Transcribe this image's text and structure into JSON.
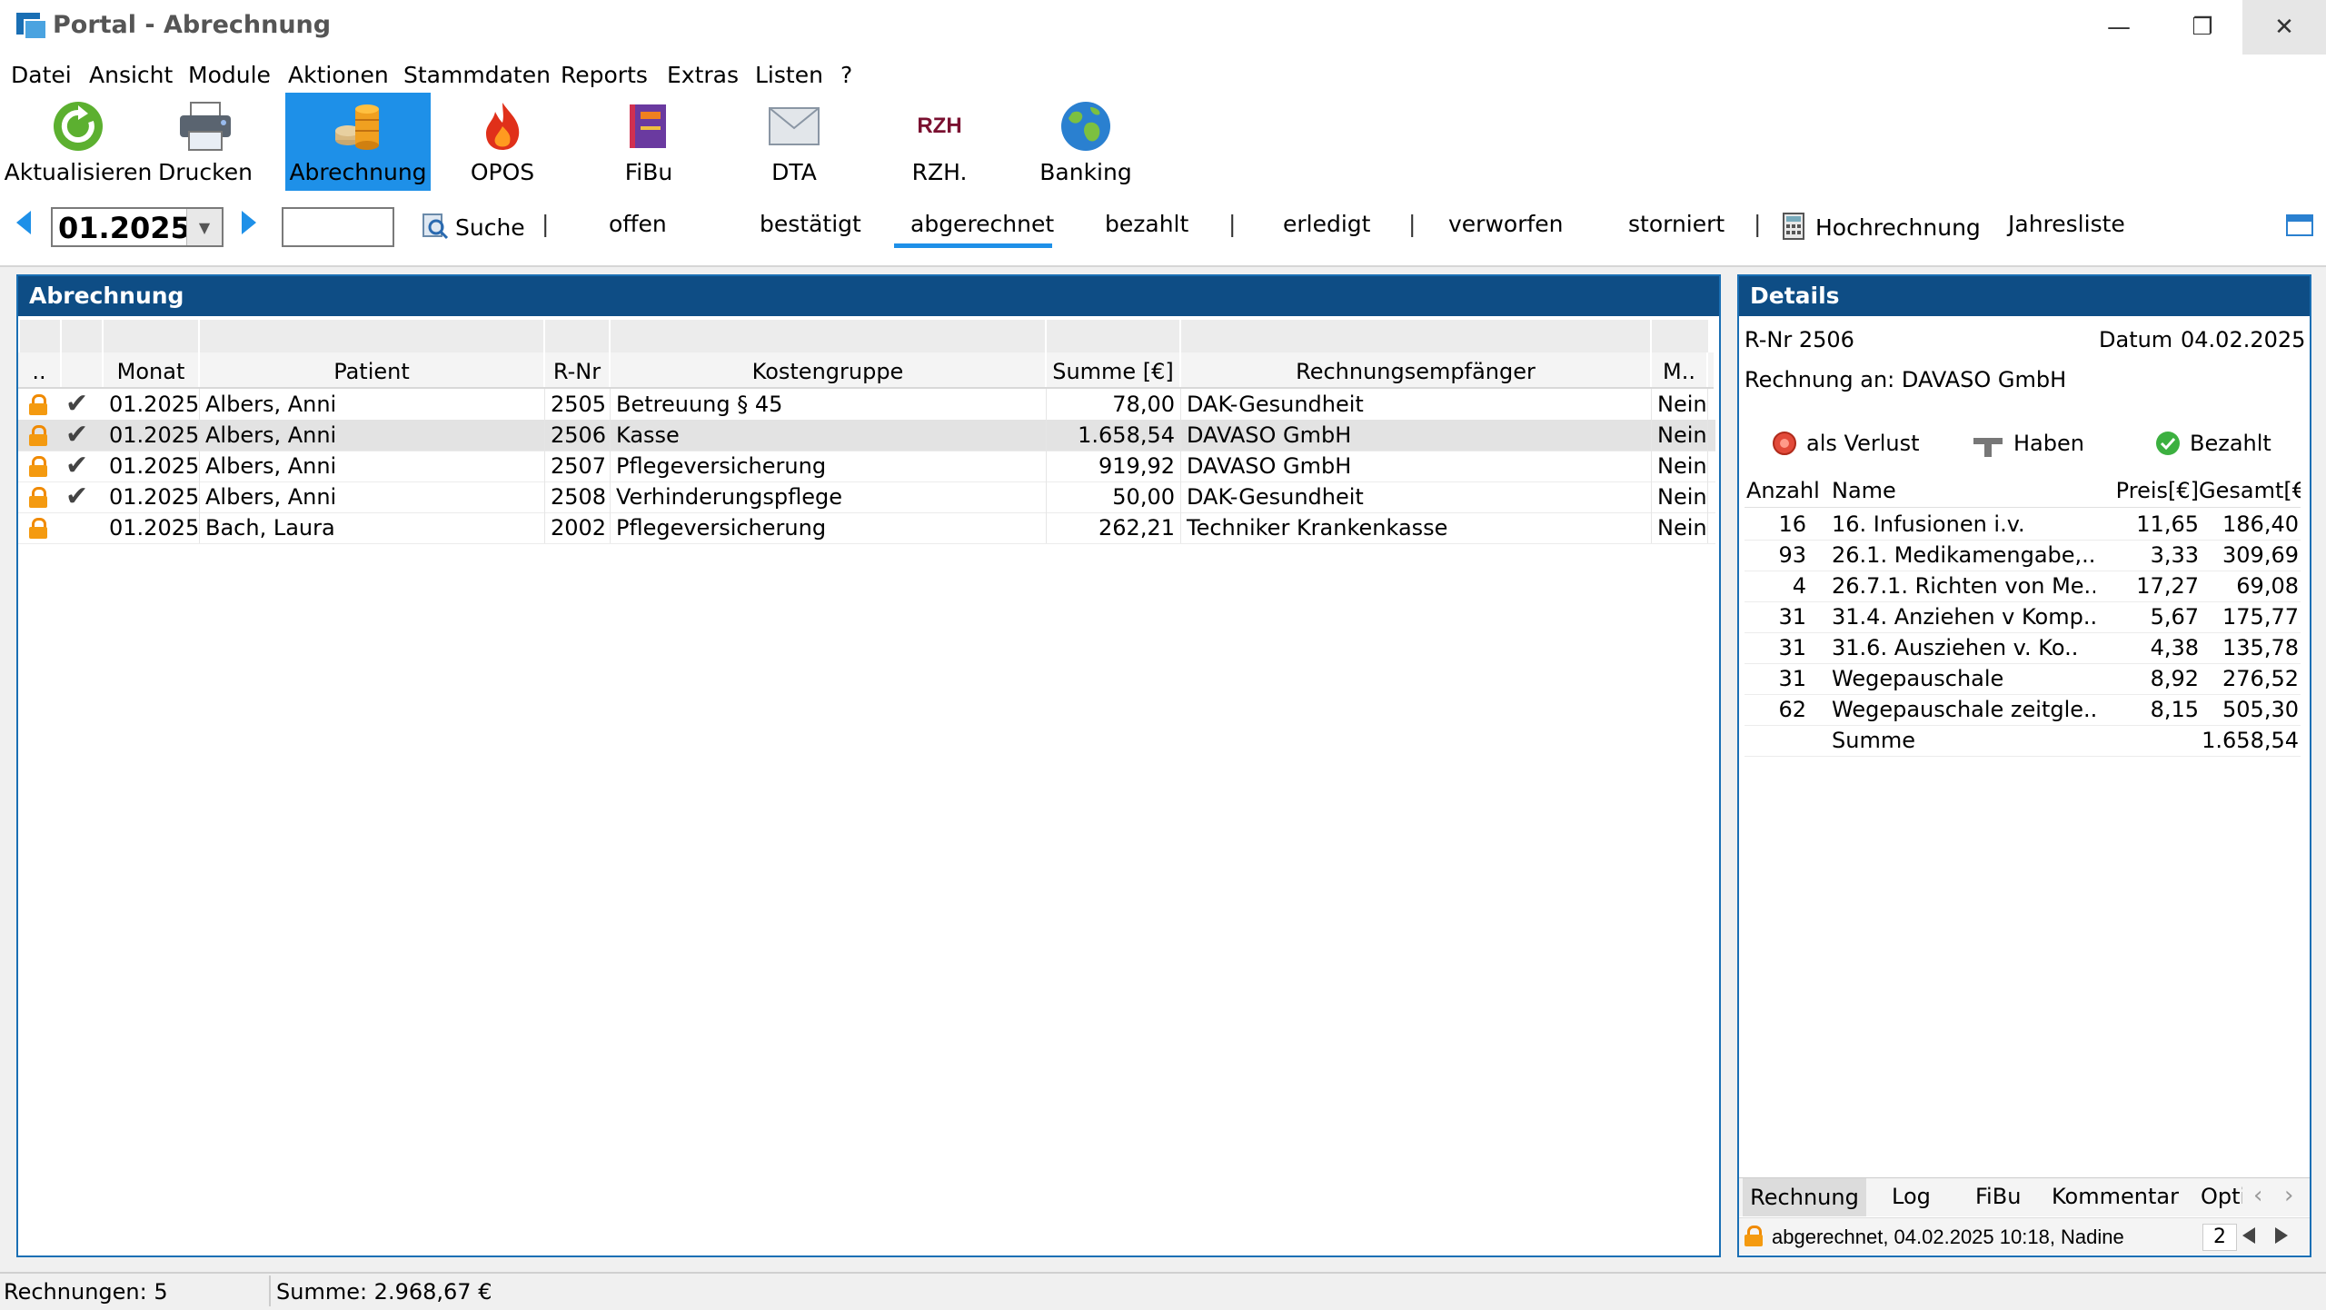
{
  "window": {
    "title": "Portal - Abrechnung"
  },
  "menu": [
    "Datei",
    "Ansicht",
    "Module",
    "Aktionen",
    "Stammdaten",
    "Reports",
    "Extras",
    "Listen",
    "?"
  ],
  "toolbar": {
    "refresh": "Aktualisieren",
    "print": "Drucken",
    "billing": "Abrechnung",
    "opos": "OPOS",
    "fibu": "FiBu",
    "dta": "DTA",
    "rzh": "RZH.",
    "rzh_logo": "RZH",
    "banking": "Banking"
  },
  "filter": {
    "month": "01.2025",
    "search_value": "",
    "search_label": "Suche",
    "tabs": [
      "offen",
      "bestätigt",
      "abgerechnet",
      "bezahlt",
      "erledigt",
      "verworfen",
      "storniert"
    ],
    "active_tab": "abgerechnet",
    "forecast": "Hochrechnung",
    "annual": "Jahresliste"
  },
  "billing_panel": {
    "title": "Abrechnung",
    "columns": [
      "..",
      "Monat",
      "Patient",
      "R-Nr",
      "Kostengruppe",
      "Summe [€]",
      "Rechnungsempfänger",
      "M.."
    ],
    "rows": [
      {
        "locked": true,
        "checked": true,
        "month": "01.2025",
        "patient": "Albers, Anni",
        "rnr": "2505",
        "group": "Betreuung § 45",
        "sum": "78,00",
        "recipient": "DAK-Gesundheit",
        "m": "Nein",
        "selected": false
      },
      {
        "locked": true,
        "checked": true,
        "month": "01.2025",
        "patient": "Albers, Anni",
        "rnr": "2506",
        "group": "Kasse",
        "sum": "1.658,54",
        "recipient": "DAVASO GmbH",
        "m": "Nein",
        "selected": true
      },
      {
        "locked": true,
        "checked": true,
        "month": "01.2025",
        "patient": "Albers, Anni",
        "rnr": "2507",
        "group": "Pflegeversicherung",
        "sum": "919,92",
        "recipient": "DAVASO GmbH",
        "m": "Nein",
        "selected": false
      },
      {
        "locked": true,
        "checked": true,
        "month": "01.2025",
        "patient": "Albers, Anni",
        "rnr": "2508",
        "group": "Verhinderungspflege",
        "sum": "50,00",
        "recipient": "DAK-Gesundheit",
        "m": "Nein",
        "selected": false
      },
      {
        "locked": true,
        "checked": false,
        "month": "01.2025",
        "patient": "Bach, Laura",
        "rnr": "2002",
        "group": "Pflegeversicherung",
        "sum": "262,21",
        "recipient": "Techniker Krankenkasse",
        "m": "Nein",
        "selected": false
      }
    ]
  },
  "details": {
    "title": "Details",
    "rnr": "R-Nr 2506",
    "date_label": "Datum",
    "date": "04.02.2025",
    "recipient": "Rechnung an: DAVASO GmbH",
    "actions": {
      "loss": "als Verlust",
      "credit": "Haben",
      "paid": "Bezahlt"
    },
    "columns": [
      "Anzahl",
      "Name",
      "Preis[€]",
      "Gesamt[€]"
    ],
    "items": [
      {
        "qty": "16",
        "name": "16. Infusionen i.v.",
        "price": "11,65",
        "total": "186,40"
      },
      {
        "qty": "93",
        "name": "26.1. Medikamengabe,..",
        "price": "3,33",
        "total": "309,69"
      },
      {
        "qty": "4",
        "name": "26.7.1. Richten von Me..",
        "price": "17,27",
        "total": "69,08"
      },
      {
        "qty": "31",
        "name": "31.4. Anziehen v Komp..",
        "price": "5,67",
        "total": "175,77"
      },
      {
        "qty": "31",
        "name": "31.6. Ausziehen v. Ko..",
        "price": "4,38",
        "total": "135,78"
      },
      {
        "qty": "31",
        "name": "Wegepauschale",
        "price": "8,92",
        "total": "276,52"
      },
      {
        "qty": "62",
        "name": "Wegepauschale zeitgle..",
        "price": "8,15",
        "total": "505,30"
      }
    ],
    "sum_label": "Summe",
    "sum_value": "1.658,54",
    "tabs": [
      "Rechnung",
      "Log",
      "FiBu",
      "Kommentar",
      "Opti"
    ],
    "active_tab": "Rechnung",
    "status": "abgerechnet, 04.02.2025 10:18, Nadine",
    "page": "2"
  },
  "statusbar": {
    "count": "Rechnungen: 5",
    "sum": "Summe: 2.968,67 €"
  },
  "colors": {
    "accent": "#1e90e8",
    "header": "#0e4d85",
    "lock": "#f49a10"
  }
}
